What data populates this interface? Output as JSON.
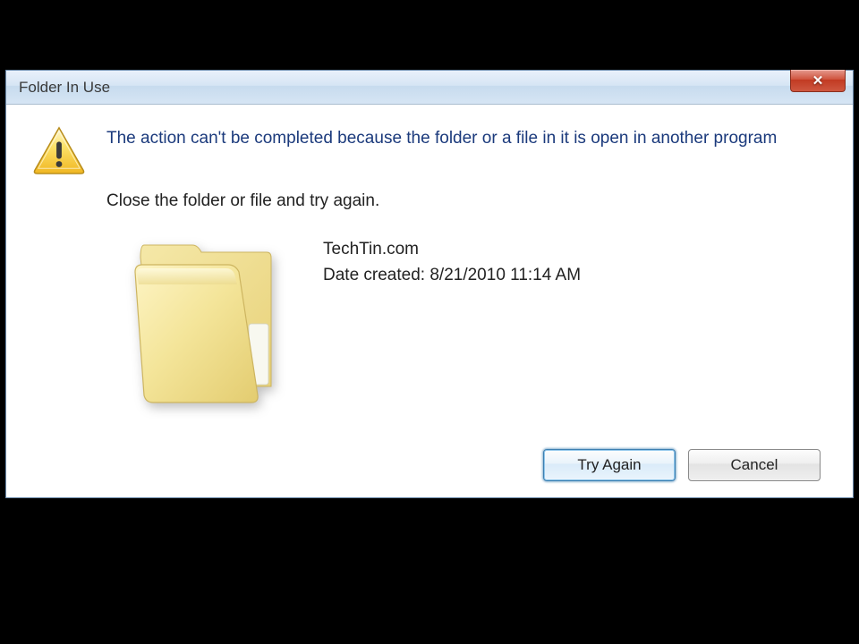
{
  "dialog": {
    "title": "Folder In Use",
    "message": "The action can't be completed because the folder or a file in it is open in another program",
    "instruction": "Close the folder or file and try again.",
    "item": {
      "name": "TechTin.com",
      "date_created_label": "Date created:",
      "date_created_value": "8/21/2010 11:14 AM"
    },
    "buttons": {
      "try_again": "Try Again",
      "cancel": "Cancel"
    }
  }
}
